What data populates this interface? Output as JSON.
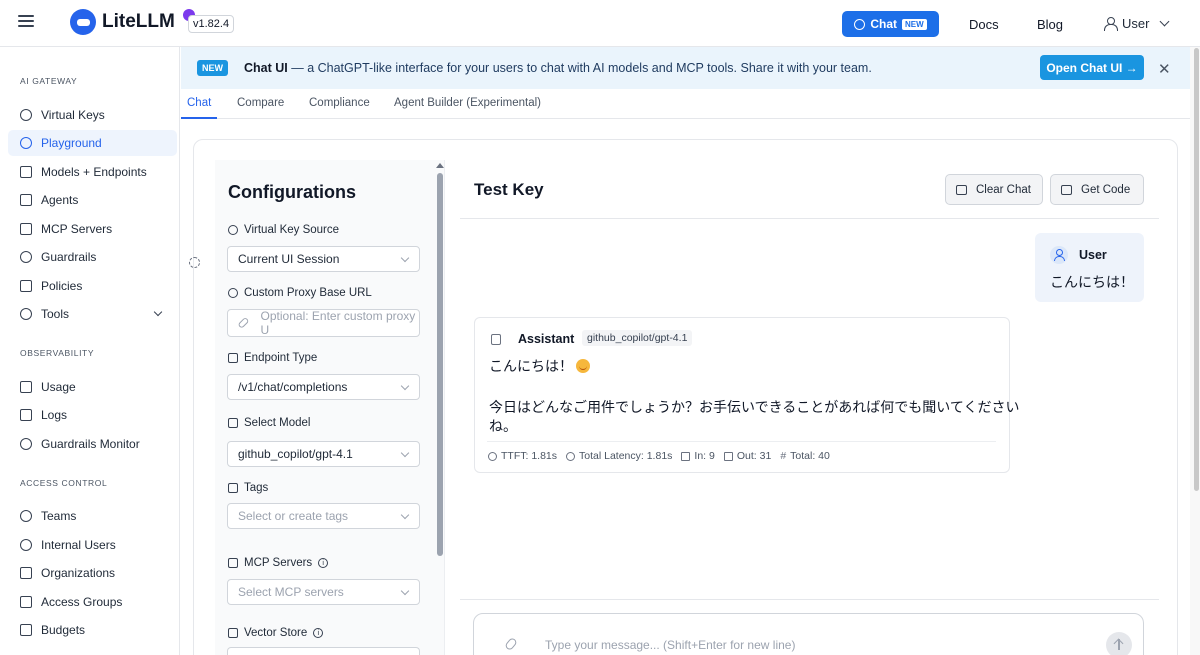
{
  "header": {
    "logo_text": "LiteLLM",
    "version": "v1.82.4",
    "chat_button": "Chat",
    "chat_badge": "NEW",
    "nav": [
      "Docs",
      "Blog"
    ],
    "user_label": "User"
  },
  "sidebar": {
    "sections": [
      {
        "title": "AI GATEWAY",
        "items": [
          {
            "label": "Virtual Keys",
            "icon": "key-icon"
          },
          {
            "label": "Playground",
            "icon": "play-circle-icon",
            "active": true
          },
          {
            "label": "Models + Endpoints",
            "icon": "box-icon"
          },
          {
            "label": "Agents",
            "icon": "robot-icon"
          },
          {
            "label": "MCP Servers",
            "icon": "server-icon"
          },
          {
            "label": "Guardrails",
            "icon": "shield-icon"
          },
          {
            "label": "Policies",
            "icon": "document-icon"
          },
          {
            "label": "Tools",
            "icon": "wrench-icon",
            "expandable": true
          }
        ]
      },
      {
        "title": "OBSERVABILITY",
        "items": [
          {
            "label": "Usage",
            "icon": "bar-chart-icon"
          },
          {
            "label": "Logs",
            "icon": "line-chart-icon"
          },
          {
            "label": "Guardrails Monitor",
            "icon": "shield-check-icon"
          }
        ]
      },
      {
        "title": "ACCESS CONTROL",
        "items": [
          {
            "label": "Teams",
            "icon": "team-icon"
          },
          {
            "label": "Internal Users",
            "icon": "user-icon"
          },
          {
            "label": "Organizations",
            "icon": "bank-icon"
          },
          {
            "label": "Access Groups",
            "icon": "group-icon"
          },
          {
            "label": "Budgets",
            "icon": "wallet-icon"
          }
        ]
      }
    ]
  },
  "banner": {
    "badge": "NEW",
    "title": "Chat UI",
    "text": " — a ChatGPT-like interface for your users to chat with AI models and MCP tools. Share it with your team.",
    "button": "Open Chat UI →",
    "close": "✕"
  },
  "tabs": [
    "Chat",
    "Compare",
    "Compliance",
    "Agent Builder (Experimental)"
  ],
  "config": {
    "title": "Configurations",
    "virtual_key_source_label": "Virtual Key Source",
    "virtual_key_source_value": "Current UI Session",
    "proxy_url_label": "Custom Proxy Base URL",
    "proxy_url_placeholder": "Optional: Enter custom proxy U",
    "endpoint_type_label": "Endpoint Type",
    "endpoint_type_value": "/v1/chat/completions",
    "model_label": "Select Model",
    "model_value": "github_copilot/gpt-4.1",
    "tags_label": "Tags",
    "tags_placeholder": "Select or create tags",
    "mcp_label": "MCP Servers",
    "mcp_placeholder": "Select MCP servers",
    "vector_label": "Vector Store"
  },
  "chat": {
    "title": "Test Key",
    "clear_button": "Clear Chat",
    "code_button": "Get Code",
    "user_name": "User",
    "user_message": "こんにちは！",
    "assistant_name": "Assistant",
    "assistant_model": "github_copilot/gpt-4.1",
    "assistant_line1": "こんにちは！",
    "assistant_line2": "今日はどんなご用件でしょうか？お手伝いできることがあれば何でも聞いてください",
    "assistant_line3": "ね。",
    "metrics": {
      "ttft": "TTFT: 1.81s",
      "latency": "Total Latency: 1.81s",
      "in": "In: 9",
      "out": "Out: 31",
      "total": "Total: 40"
    },
    "input_placeholder": "Type your message... (Shift+Enter for new line)"
  },
  "colors": {
    "accent": "#2563eb",
    "banner_bg": "#eaf4fc",
    "banner_accent": "#1a95e0"
  }
}
